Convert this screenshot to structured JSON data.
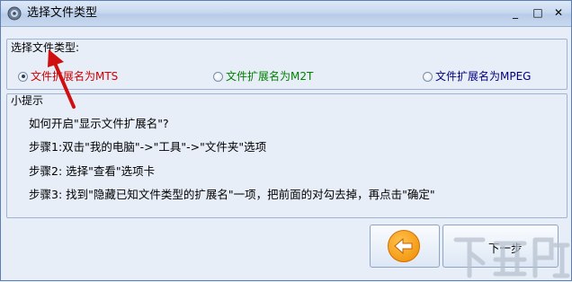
{
  "window": {
    "title": "选择文件类型",
    "minimize": "_",
    "maximize": "□",
    "close": "✕"
  },
  "file_type_group": {
    "legend": "选择文件类型:",
    "options": [
      {
        "label": "文件扩展名为MTS",
        "checked": true,
        "color": "#d00000"
      },
      {
        "label": "文件扩展名为M2T",
        "checked": false,
        "color": "#008000"
      },
      {
        "label": "文件扩展名为MPEG",
        "checked": false,
        "color": "#00007f"
      }
    ]
  },
  "tips_group": {
    "legend": "小提示",
    "lines": [
      "如何开启\"显示文件扩展名\"?",
      "步骤1:双击\"我的电脑\"->\"工具\"->\"文件夹\"选项",
      "步骤2: 选择\"查看\"选项卡",
      "步骤3: 找到\"隐藏已知文件类型的扩展名\"一项，把前面的对勾去掉，再点击\"确定\""
    ]
  },
  "buttons": {
    "back_icon": "left-arrow-icon",
    "next_label": "下一步"
  },
  "annotation": {
    "color": "#d01010"
  },
  "watermark": {
    "text": "下载吧"
  }
}
